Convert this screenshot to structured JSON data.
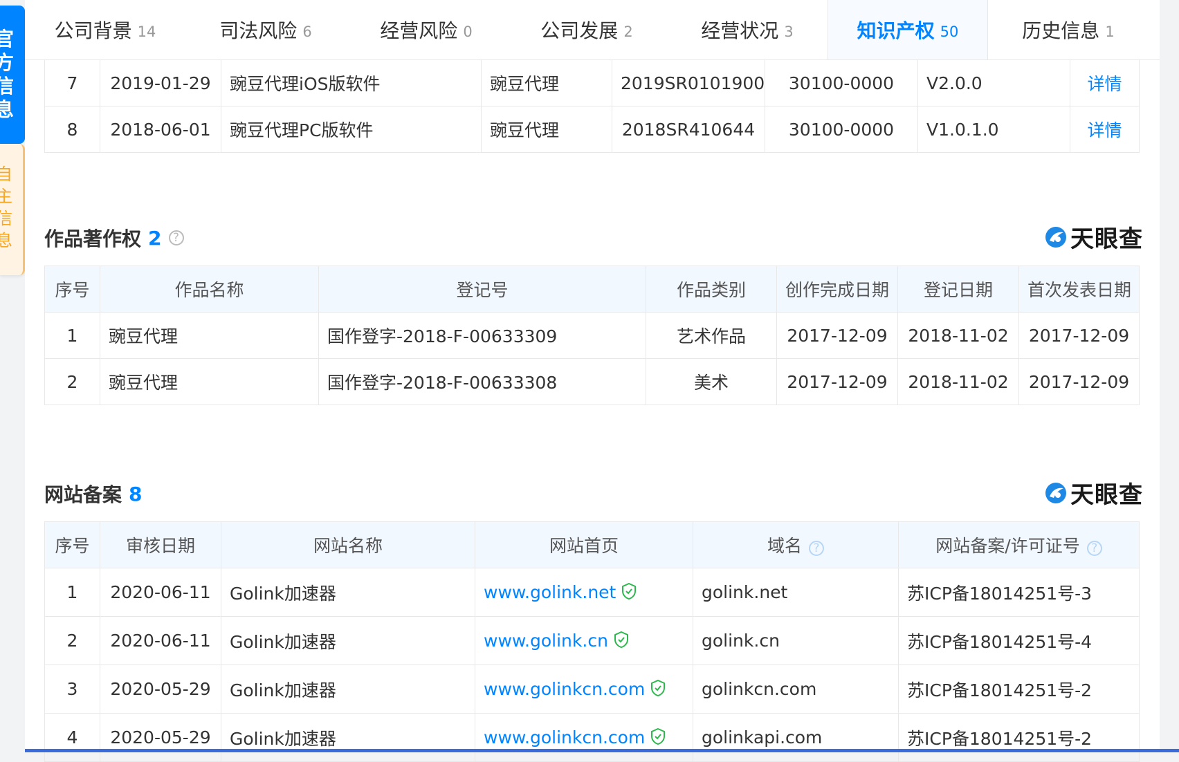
{
  "side": {
    "official": "官方信息",
    "self": "自主信息"
  },
  "nav": [
    {
      "label": "公司背景",
      "count": "14"
    },
    {
      "label": "司法风险",
      "count": "6"
    },
    {
      "label": "经营风险",
      "count": "0"
    },
    {
      "label": "公司发展",
      "count": "2"
    },
    {
      "label": "经营状况",
      "count": "3"
    },
    {
      "label": "知识产权",
      "count": "50"
    },
    {
      "label": "历史信息",
      "count": "1"
    }
  ],
  "software": {
    "rows": [
      {
        "no": "7",
        "date": "2019-01-29",
        "name": "豌豆代理iOS版软件",
        "short": "豌豆代理",
        "reg": "2019SR0101900",
        "cls": "30100-0000",
        "ver": "V2.0.0",
        "action": "详情"
      },
      {
        "no": "8",
        "date": "2018-06-01",
        "name": "豌豆代理PC版软件",
        "short": "豌豆代理",
        "reg": "2018SR410644",
        "cls": "30100-0000",
        "ver": "V1.0.1.0",
        "action": "详情"
      }
    ]
  },
  "works": {
    "title": "作品著作权",
    "count": "2",
    "brand": "天眼查",
    "headers": [
      "序号",
      "作品名称",
      "登记号",
      "作品类别",
      "创作完成日期",
      "登记日期",
      "首次发表日期"
    ],
    "rows": [
      {
        "no": "1",
        "name": "豌豆代理",
        "reg": "国作登字-2018-F-00633309",
        "type": "艺术作品",
        "done": "2017-12-09",
        "regdate": "2018-11-02",
        "pub": "2017-12-09"
      },
      {
        "no": "2",
        "name": "豌豆代理",
        "reg": "国作登字-2018-F-00633308",
        "type": "美术",
        "done": "2017-12-09",
        "regdate": "2018-11-02",
        "pub": "2017-12-09"
      }
    ]
  },
  "sites": {
    "title": "网站备案",
    "count": "8",
    "brand": "天眼查",
    "headers": [
      "序号",
      "审核日期",
      "网站名称",
      "网站首页",
      "域名",
      "网站备案/许可证号"
    ],
    "rows": [
      {
        "no": "1",
        "date": "2020-06-11",
        "name": "Golink加速器",
        "home": "www.golink.net",
        "domain": "golink.net",
        "icp": "苏ICP备18014251号-3"
      },
      {
        "no": "2",
        "date": "2020-06-11",
        "name": "Golink加速器",
        "home": "www.golink.cn",
        "domain": "golink.cn",
        "icp": "苏ICP备18014251号-4"
      },
      {
        "no": "3",
        "date": "2020-05-29",
        "name": "Golink加速器",
        "home": "www.golinkcn.com",
        "domain": "golinkcn.com",
        "icp": "苏ICP备18014251号-2"
      },
      {
        "no": "4",
        "date": "2020-05-29",
        "name": "Golink加速器",
        "home": "www.golinkcn.com",
        "domain": "golinkapi.com",
        "icp": "苏ICP备18014251号-2"
      }
    ]
  }
}
